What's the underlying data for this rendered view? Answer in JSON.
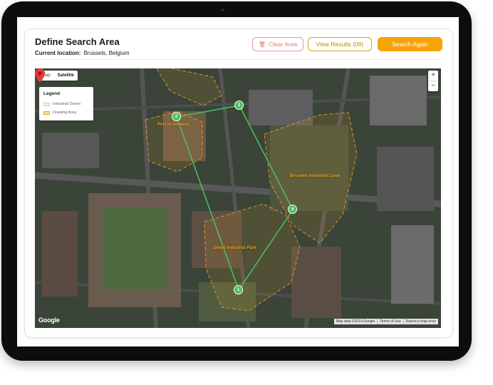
{
  "header": {
    "title": "Define Search Area",
    "location_label": "Current location:",
    "location_value": "Brussels, Belgium"
  },
  "buttons": {
    "clear": "Clear Area",
    "view_results": "View Results (09)",
    "search_again": "Search Again"
  },
  "map": {
    "type_options": [
      "Map",
      "Satellite"
    ],
    "active_type": "Satellite",
    "legend": {
      "title": "Legend",
      "items": [
        {
          "label": "Industrial Zones",
          "color": "#f6ecd2"
        },
        {
          "label": "Drawing Area",
          "color": "#f6e3a2"
        }
      ]
    },
    "zoom": {
      "in": "+",
      "out": "−"
    },
    "zones": [
      "Port of Antwerp",
      "Brussels Industrial Zone",
      "Ghent Industrial Park"
    ],
    "waypoints": [
      "1",
      "2",
      "3",
      "4"
    ],
    "attribution": [
      "Map data ©2019 Google",
      "Terms of Use",
      "Report a map error"
    ],
    "logo": "Google",
    "colors": {
      "route": "#4ec05e",
      "zone_outline": "#d9922a",
      "accent": "#f5a308",
      "marker": "#e53935"
    }
  }
}
